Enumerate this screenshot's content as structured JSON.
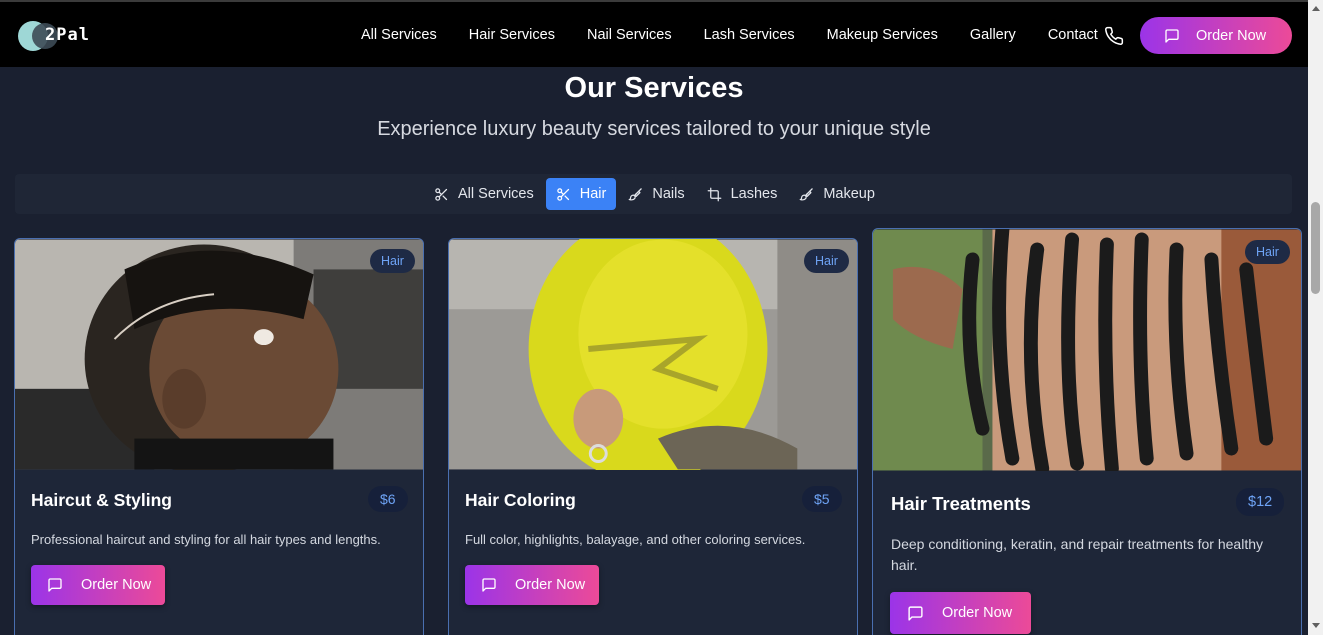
{
  "brand": {
    "name": "2Pal"
  },
  "nav": {
    "links": [
      "All Services",
      "Hair Services",
      "Nail Services",
      "Lash Services",
      "Makeup Services",
      "Gallery",
      "Contact"
    ],
    "phone_icon": "phone-icon",
    "order_label": "Order Now"
  },
  "section": {
    "title": "Our Services",
    "subtitle": "Experience luxury beauty services tailored to your unique style"
  },
  "filters": [
    {
      "label": "All Services",
      "icon": "scissors-icon",
      "active": false
    },
    {
      "label": "Hair",
      "icon": "scissors-icon",
      "active": true
    },
    {
      "label": "Nails",
      "icon": "brush-icon",
      "active": false
    },
    {
      "label": "Lashes",
      "icon": "crop-icon",
      "active": false
    },
    {
      "label": "Makeup",
      "icon": "brush-icon",
      "active": false
    }
  ],
  "cards": [
    {
      "category": "Hair",
      "title": "Haircut & Styling",
      "price": "$6",
      "description": "Professional haircut and styling for all hair types and lengths.",
      "button": "Order Now"
    },
    {
      "category": "Hair",
      "title": "Hair Coloring",
      "price": "$5",
      "description": "Full color, highlights, balayage, and other coloring services.",
      "button": "Order Now"
    },
    {
      "category": "Hair",
      "title": "Hair Treatments",
      "price": "$12",
      "description": "Deep conditioning, keratin, and repair treatments for healthy hair.",
      "button": "Order Now"
    }
  ],
  "colors": {
    "accent_start": "#9b34e8",
    "accent_end": "#ec4a98",
    "active_filter": "#3b82f6",
    "background": "#1a2030"
  }
}
